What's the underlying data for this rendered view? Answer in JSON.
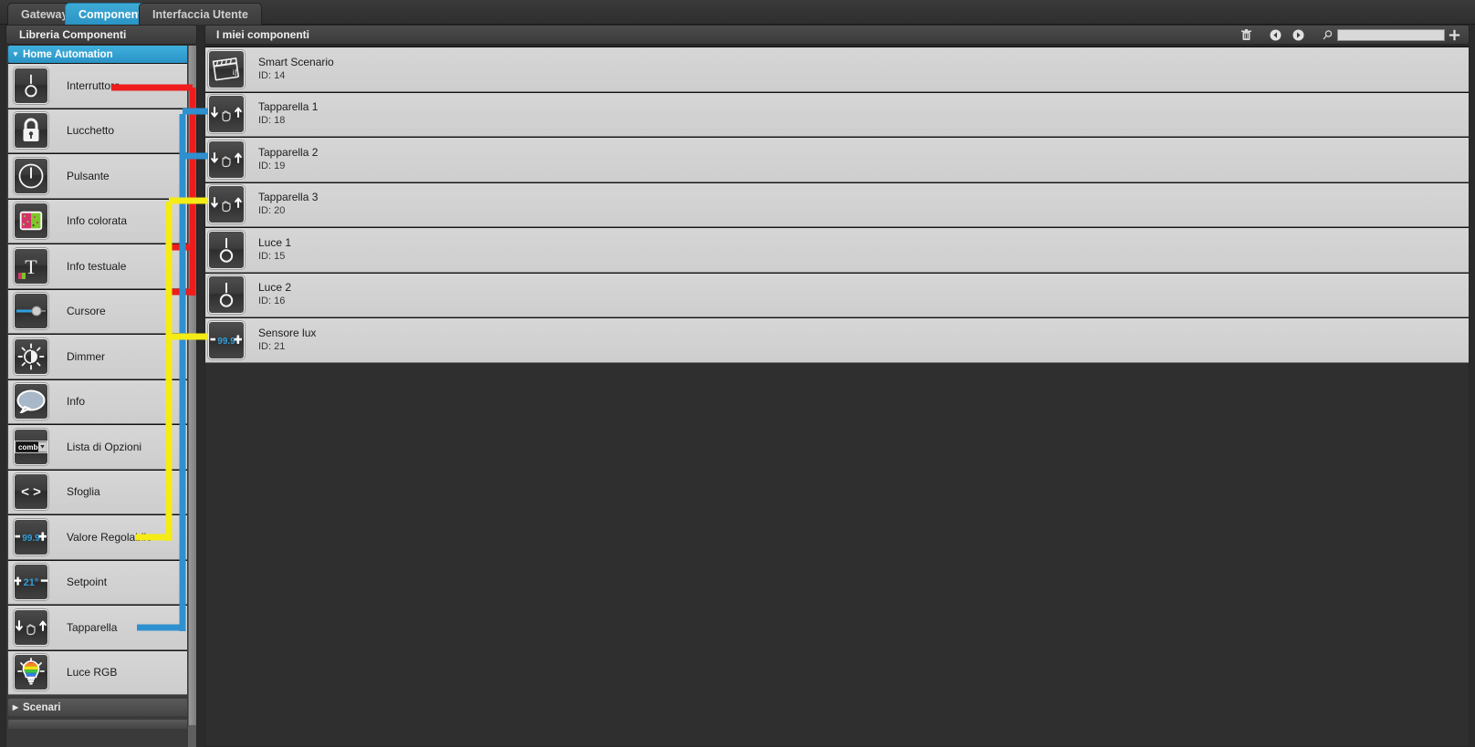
{
  "tabs": [
    {
      "label": "Gateways",
      "active": false
    },
    {
      "label": "Componenti",
      "active": true
    },
    {
      "label": "Interfaccia Utente",
      "active": false
    }
  ],
  "library": {
    "header": "Libreria Componenti",
    "groups": [
      {
        "label": "Home Automation",
        "expanded": true
      },
      {
        "label": "Scenari",
        "expanded": false
      }
    ],
    "items": [
      {
        "label": "Interruttore",
        "icon": "switch-icon"
      },
      {
        "label": "Lucchetto",
        "icon": "lock-icon"
      },
      {
        "label": "Pulsante",
        "icon": "power-button-icon"
      },
      {
        "label": "Info colorata",
        "icon": "color-info-icon"
      },
      {
        "label": "Info testuale",
        "icon": "text-info-icon"
      },
      {
        "label": "Cursore",
        "icon": "slider-icon"
      },
      {
        "label": "Dimmer",
        "icon": "dimmer-icon"
      },
      {
        "label": "Info",
        "icon": "speech-bubble-icon"
      },
      {
        "label": "Lista di Opzioni",
        "icon": "combo-box-icon"
      },
      {
        "label": "Sfoglia",
        "icon": "browse-icon"
      },
      {
        "label": "Valore Regolabile",
        "icon": "adjustable-value-icon"
      },
      {
        "label": "Setpoint",
        "icon": "setpoint-icon"
      },
      {
        "label": "Tapparella",
        "icon": "shutter-icon"
      },
      {
        "label": "Luce RGB",
        "icon": "rgb-light-icon"
      }
    ]
  },
  "main": {
    "header": "I miei componenti",
    "toolbar": {
      "delete_icon": "trash-icon",
      "prev_icon": "arrow-left-circle-icon",
      "next_icon": "arrow-right-circle-icon",
      "search_icon": "search-icon",
      "search_value": "",
      "search_placeholder": "",
      "add_icon": "plus-icon"
    },
    "rows": [
      {
        "title": "Smart Scenario",
        "sub": "ID: 14",
        "icon": "clapperboard-icon",
        "wire": "none"
      },
      {
        "title": "Tapparella 1",
        "sub": "ID: 18",
        "icon": "shutter-icon",
        "wire": "blue"
      },
      {
        "title": "Tapparella 2",
        "sub": "ID: 19",
        "icon": "shutter-icon",
        "wire": "blue"
      },
      {
        "title": "Tapparella 3",
        "sub": "ID: 20",
        "icon": "shutter-icon",
        "wire": "yellow"
      },
      {
        "title": "Luce 1",
        "sub": "ID: 15",
        "icon": "switch-icon",
        "wire": "red"
      },
      {
        "title": "Luce 2",
        "sub": "ID: 16",
        "icon": "switch-icon",
        "wire": "red"
      },
      {
        "title": "Sensore lux",
        "sub": "ID: 21",
        "icon": "adjustable-value-icon",
        "wire": "yellow"
      }
    ]
  },
  "wire_colors": {
    "red": "#ee1c1c",
    "blue": "#2f90d0",
    "yellow": "#f5eb15"
  },
  "accent": "#2f9fce"
}
